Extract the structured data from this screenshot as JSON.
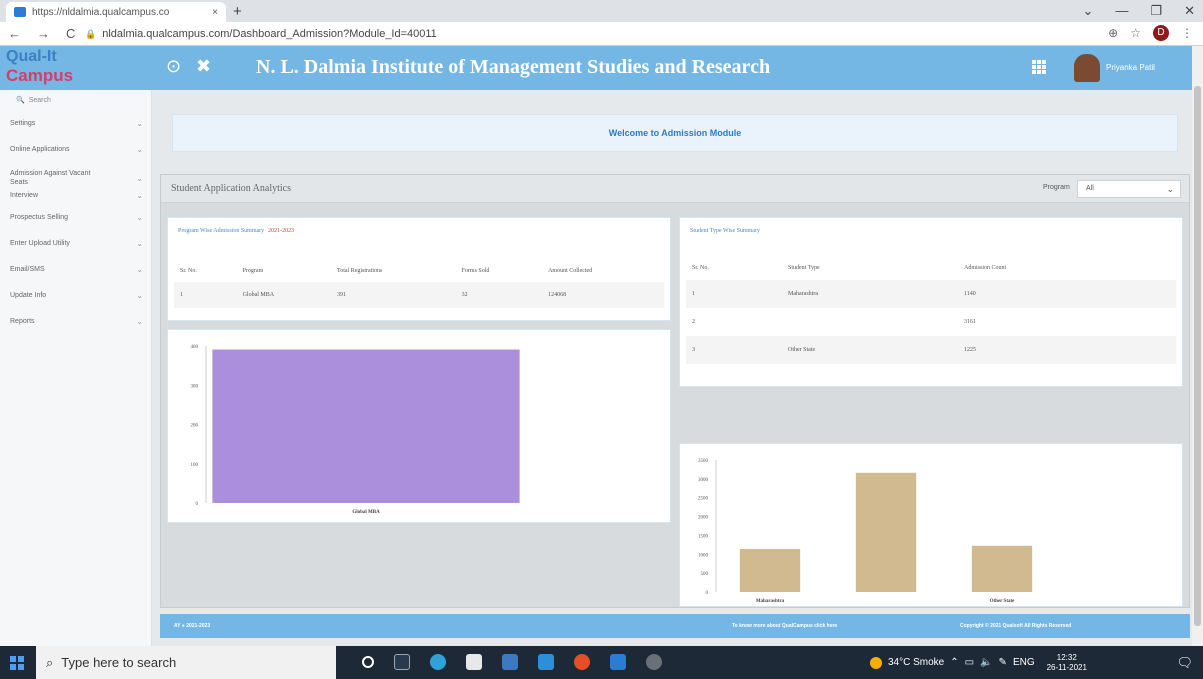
{
  "browser": {
    "tab_title": "https://nldalmia.qualcampus.co",
    "close": "×",
    "new_tab": "+",
    "url": "nldalmia.qualcampus.com/Dashboard_Admission?Module_Id=40011",
    "nav": {
      "back": "←",
      "forward": "→",
      "reload": "C"
    },
    "profile_initial": "D",
    "window": {
      "minimize": "—",
      "restore": "❐",
      "close": "✕",
      "dropdown": "⌄"
    }
  },
  "app": {
    "logo": {
      "line1": "Qual-It",
      "line2": "Campus"
    },
    "header_title": "N. L. Dalmia Institute of Management Studies and Research",
    "user_name": "Priyanka Patil",
    "welcome": "Welcome to Admission Module"
  },
  "sidebar": {
    "search_placeholder": "Search",
    "items": [
      {
        "label": "Settings"
      },
      {
        "label": "Online Applications"
      },
      {
        "label": "Admission Against Vacant Seats"
      },
      {
        "label": "Interview"
      },
      {
        "label": "Prospectus Selling"
      },
      {
        "label": "Enter Upload Utility"
      },
      {
        "label": "Email/SMS"
      },
      {
        "label": "Update Info"
      },
      {
        "label": "Reports"
      }
    ]
  },
  "analytics": {
    "title": "Student Application Analytics",
    "program_label": "Program",
    "program_value": "All",
    "program_card": {
      "title": "Program Wise Admission Summary",
      "year": "2021-2023",
      "headers": [
        "Sr. No.",
        "Program",
        "Total Registrations",
        "Forms Sold",
        "Amount Collected"
      ],
      "rows": [
        [
          "1",
          "Global MBA",
          "391",
          "32",
          "124068"
        ]
      ]
    },
    "student_card": {
      "title": "Student Type Wise Summary",
      "headers": [
        "Sr. No.",
        "Student Type",
        "Admission Count"
      ],
      "rows": [
        [
          "1",
          "Maharashtra",
          "1140"
        ],
        [
          "2",
          "",
          "3161"
        ],
        [
          "3",
          "Other State",
          "1225"
        ]
      ]
    }
  },
  "footer": {
    "left": "AY ● 2021-2023",
    "center": "To know more about QualCampus click here",
    "right": "Copyright © 2021 Qualsoft All Rights Reserved"
  },
  "taskbar": {
    "search_placeholder": "Type here to search",
    "weather": "34°C Smoke",
    "lang": "ENG",
    "time": "12:32",
    "date": "26-11-2021"
  },
  "colors": {
    "header": "#74b7e4",
    "bar_program": "#ac8fdc",
    "bar_student": "#d1ba90",
    "accent": "#2d7bc6"
  },
  "chart_data": [
    {
      "type": "bar",
      "categories": [
        "Global MBA"
      ],
      "values": [
        391
      ],
      "ylim": [
        0,
        400
      ],
      "yticks": [
        "0",
        "100",
        "200",
        "300",
        "400"
      ]
    },
    {
      "type": "bar",
      "categories": [
        "Maharashtra",
        "",
        "Other State"
      ],
      "values": [
        1140,
        3161,
        1225
      ],
      "ylim": [
        0,
        3500
      ],
      "yticks": [
        "0",
        "500",
        "1000",
        "1500",
        "2000",
        "2500",
        "3000",
        "3500"
      ]
    }
  ]
}
